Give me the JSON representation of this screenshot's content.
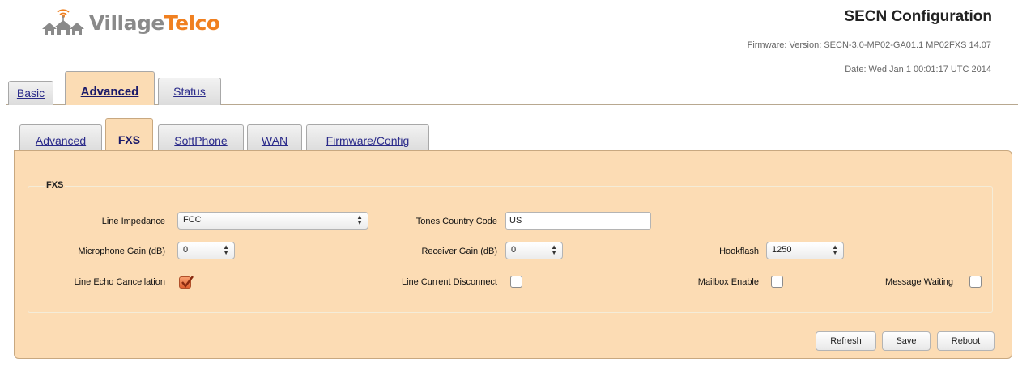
{
  "logo": {
    "brand_part1": "Village",
    "brand_part2": "Telco"
  },
  "header": {
    "title": "SECN Configuration",
    "firmware": "Firmware: Version: SECN-3.0-MP02-GA01.1 MP02FXS 14.07",
    "date": "Date: Wed Jan 1 00:01:17 UTC 2014"
  },
  "main_tabs": [
    {
      "label": "Basic"
    },
    {
      "label": "Advanced",
      "active": true
    },
    {
      "label": "Status"
    }
  ],
  "sub_tabs": [
    {
      "label": "Advanced"
    },
    {
      "label": "FXS",
      "active": true
    },
    {
      "label": "SoftPhone"
    },
    {
      "label": "WAN"
    },
    {
      "label": "Firmware/Config"
    }
  ],
  "fxs": {
    "legend": "FXS",
    "line_impedance": {
      "label": "Line Impedance",
      "value": "FCC"
    },
    "tones_country_code": {
      "label": "Tones Country Code",
      "value": "US"
    },
    "microphone_gain": {
      "label": "Microphone Gain (dB)",
      "value": "0"
    },
    "receiver_gain": {
      "label": "Receiver Gain (dB)",
      "value": "0"
    },
    "hookflash": {
      "label": "Hookflash",
      "value": "1250"
    },
    "line_echo_cancellation": {
      "label": "Line Echo Cancellation",
      "checked": true
    },
    "line_current_disconnect": {
      "label": "Line Current Disconnect",
      "checked": false
    },
    "mailbox_enable": {
      "label": "Mailbox Enable",
      "checked": false
    },
    "message_waiting": {
      "label": "Message Waiting",
      "checked": false
    }
  },
  "buttons": {
    "refresh": "Refresh",
    "save": "Save",
    "reboot": "Reboot"
  },
  "colors": {
    "panel": "#fcdcb4",
    "accent": "#f08020",
    "checkbox_on": "#e06030"
  }
}
